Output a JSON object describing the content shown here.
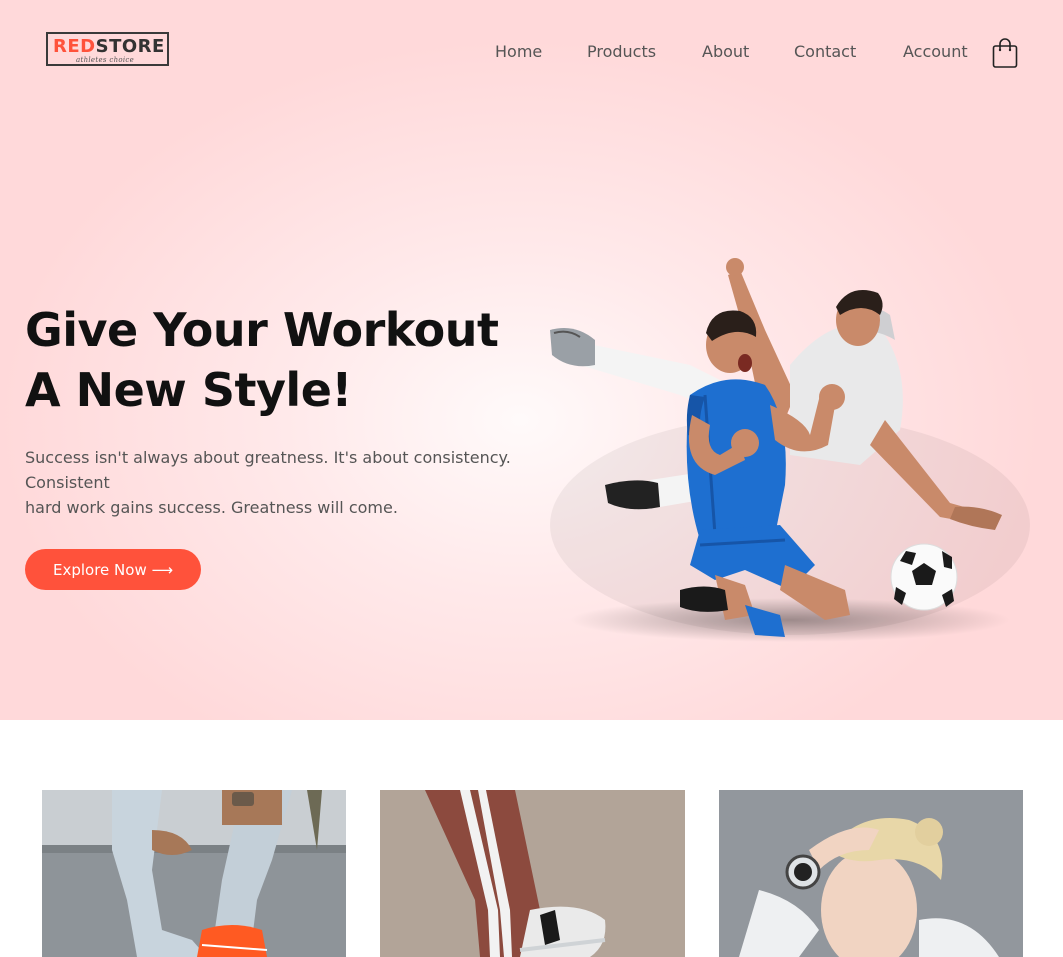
{
  "brand": {
    "name_red": "RED",
    "name_dark": "STORE",
    "tagline": "athletes choice",
    "accent_color": "#ff523b"
  },
  "nav": {
    "items": [
      {
        "label": "Home"
      },
      {
        "label": "Products"
      },
      {
        "label": "About"
      },
      {
        "label": "Contact"
      },
      {
        "label": "Account"
      }
    ],
    "cart_icon": "shopping-bag-icon"
  },
  "hero": {
    "headline_line1": "Give Your Workout",
    "headline_line2": "A New Style!",
    "subtext_line1": "Success isn't always about greatness. It's about consistency.",
    "subtext_line2": "Consistent",
    "subtext_line3": "hard work gains success. Greatness will come.",
    "cta_label": "Explore Now ⟶",
    "image_subject": "two soccer players celebrating with a ball"
  },
  "categories": [
    {
      "image_subject": "person in ripped jeans and orange sneakers"
    },
    {
      "image_subject": "striped track pants with white sneaker"
    },
    {
      "image_subject": "woman wearing smartwatch"
    }
  ]
}
